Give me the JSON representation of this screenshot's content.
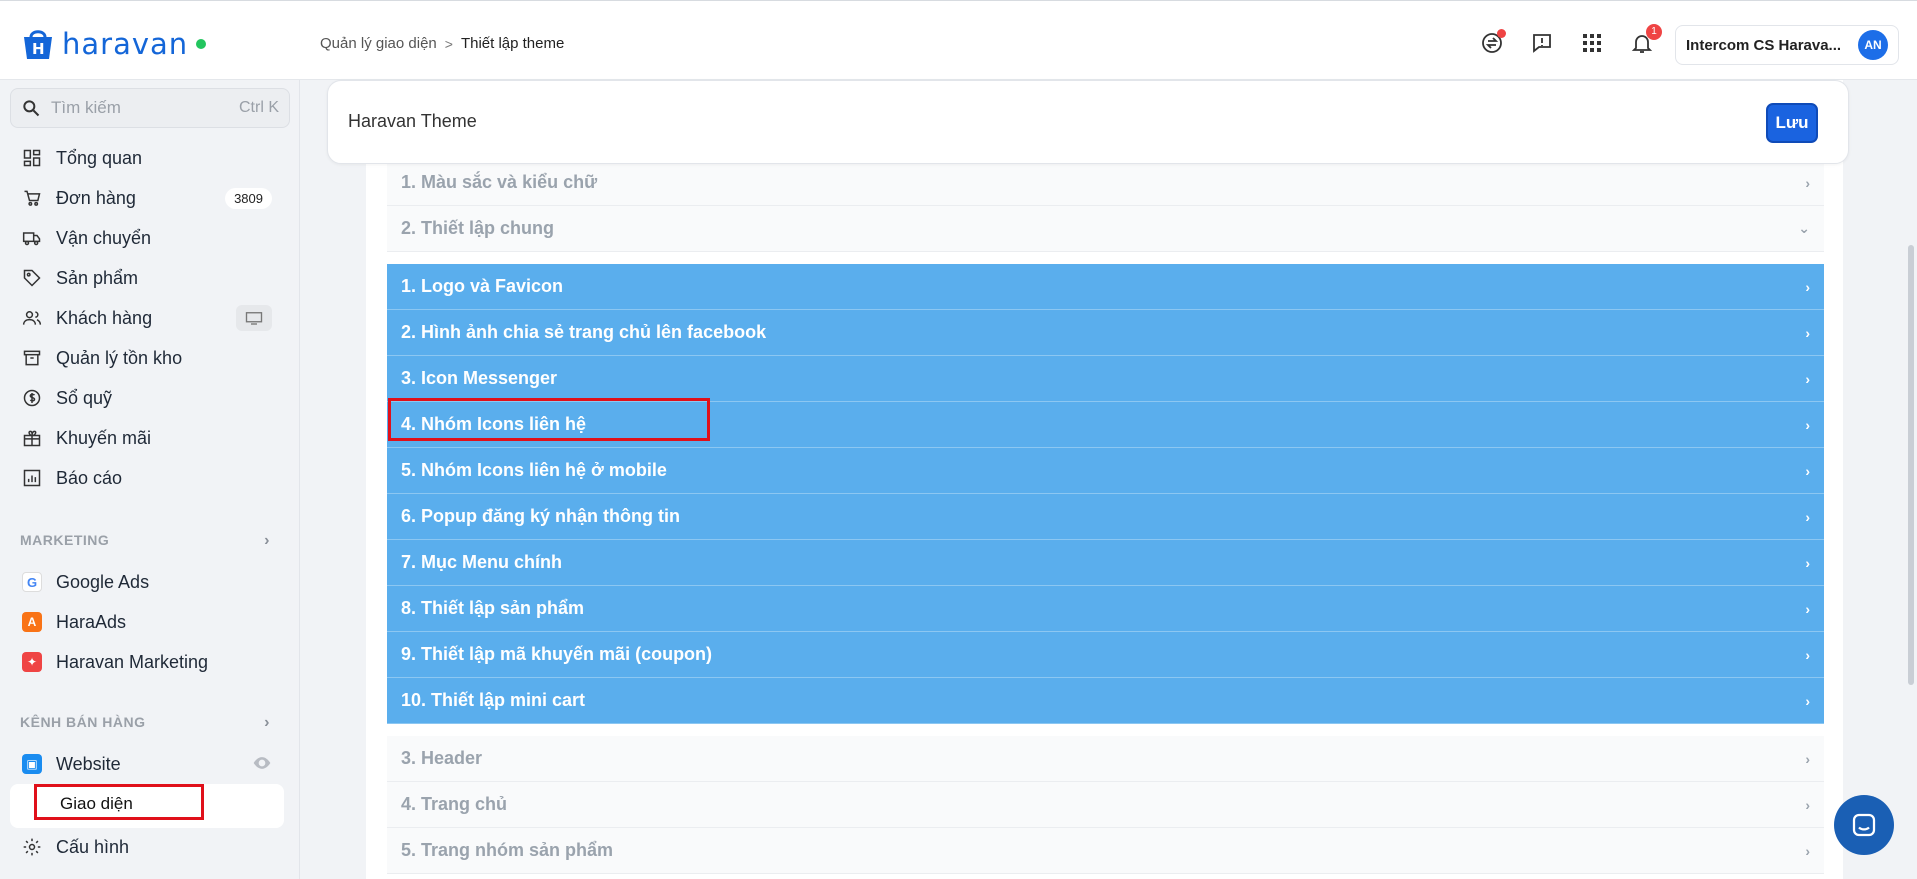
{
  "app": {
    "brand": "haravan",
    "brand_color": "#1466d8"
  },
  "breadcrumb": {
    "parent": "Quản lý giao diện",
    "separator": ">",
    "current": "Thiết lập theme"
  },
  "topbar": {
    "icons": [
      "exchange-icon",
      "feedback-icon",
      "apps-grid-icon",
      "bell-icon"
    ],
    "notification_count": "1",
    "account_name": "Intercom CS Harava...",
    "avatar_initials": "AN"
  },
  "sidebar": {
    "search_placeholder": "Tìm kiếm",
    "search_shortcut": "Ctrl K",
    "items": [
      {
        "label": "Tổng quan",
        "icon": "dashboard-icon"
      },
      {
        "label": "Đơn hàng",
        "icon": "cart-icon",
        "badge": "3809"
      },
      {
        "label": "Vận chuyển",
        "icon": "truck-icon"
      },
      {
        "label": "Sản phẩm",
        "icon": "tag-icon"
      },
      {
        "label": "Khách hàng",
        "icon": "users-icon"
      },
      {
        "label": "Quản lý tồn kho",
        "icon": "archive-icon"
      },
      {
        "label": "Sổ quỹ",
        "icon": "dollar-icon"
      },
      {
        "label": "Khuyến mãi",
        "icon": "gift-icon"
      },
      {
        "label": "Báo cáo",
        "icon": "report-icon"
      }
    ],
    "marketing_title": "MARKETING",
    "marketing_items": [
      {
        "label": "Google Ads",
        "icon": "google-icon"
      },
      {
        "label": "HaraAds",
        "icon": "haraads-icon"
      },
      {
        "label": "Haravan Marketing",
        "icon": "haravan-marketing-icon"
      }
    ],
    "channels_title": "KÊNH BÁN HÀNG",
    "website_label": "Website",
    "sub_item_label": "Giao diện",
    "settings_label": "Cấu hình"
  },
  "main": {
    "theme_title": "Haravan Theme",
    "save_label": "Lưu",
    "sections_top": [
      {
        "label": "1. Màu sắc và kiểu chữ",
        "chevron": "›"
      },
      {
        "label": "2. Thiết lập chung",
        "chevron": "⌄"
      }
    ],
    "sub_sections": [
      "1. Logo và Favicon",
      "2. Hình ảnh chia sẻ trang chủ lên facebook",
      "3. Icon Messenger",
      "4. Nhóm Icons liên hệ",
      "5. Nhóm Icons liên hệ ở mobile",
      "6. Popup đăng ký nhận thông tin",
      "7. Mục Menu chính",
      "8. Thiết lập sản phẩm",
      "9. Thiết lập mã khuyến mãi (coupon)",
      "10. Thiết lập mini cart"
    ],
    "sections_bottom": [
      "3. Header",
      "4. Trang chủ",
      "5. Trang nhóm sản phẩm"
    ]
  },
  "colors": {
    "accent": "#1a63e0",
    "row_blue": "#5aaeed",
    "highlight": "#e0101a"
  }
}
